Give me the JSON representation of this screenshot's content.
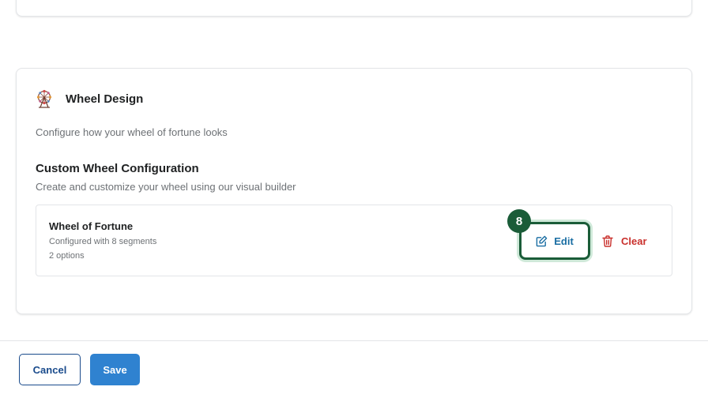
{
  "card": {
    "title": "Wheel Design",
    "icon": "ferris-wheel-icon",
    "description": "Configure how your wheel of fortune looks"
  },
  "section": {
    "title": "Custom Wheel Configuration",
    "description": "Create and customize your wheel using our visual builder"
  },
  "wheel": {
    "name": "Wheel of Fortune",
    "segments_text": "Configured with 8 segments",
    "options_text": "2 options"
  },
  "actions": {
    "edit_label": "Edit",
    "edit_badge": "8",
    "clear_label": "Clear"
  },
  "footer": {
    "cancel_label": "Cancel",
    "save_label": "Save"
  },
  "colors": {
    "primary": "#2f82d0",
    "badge": "#1a5c38",
    "danger": "#c9302c",
    "edit_text": "#1a6ea3"
  }
}
